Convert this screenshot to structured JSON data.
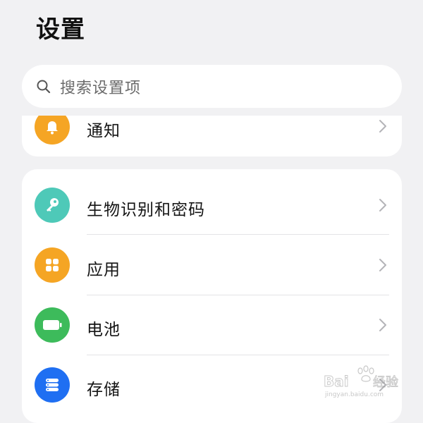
{
  "header": {
    "title": "设置"
  },
  "search": {
    "placeholder": "搜索设置项",
    "icon": "search-icon"
  },
  "notify_item": {
    "label": "通知",
    "icon": "bell-icon",
    "icon_color": "#f5a524"
  },
  "items": [
    {
      "label": "生物识别和密码",
      "icon": "key-icon",
      "icon_color": "#4ec9b8"
    },
    {
      "label": "应用",
      "icon": "apps-grid-icon",
      "icon_color": "#f5a524"
    },
    {
      "label": "电池",
      "icon": "battery-icon",
      "icon_color": "#3dbb5b"
    },
    {
      "label": "存储",
      "icon": "storage-icon",
      "icon_color": "#1f6ff2"
    }
  ],
  "watermark": {
    "brand": "Baidu经验",
    "url": "jingyan.baidu.com"
  }
}
